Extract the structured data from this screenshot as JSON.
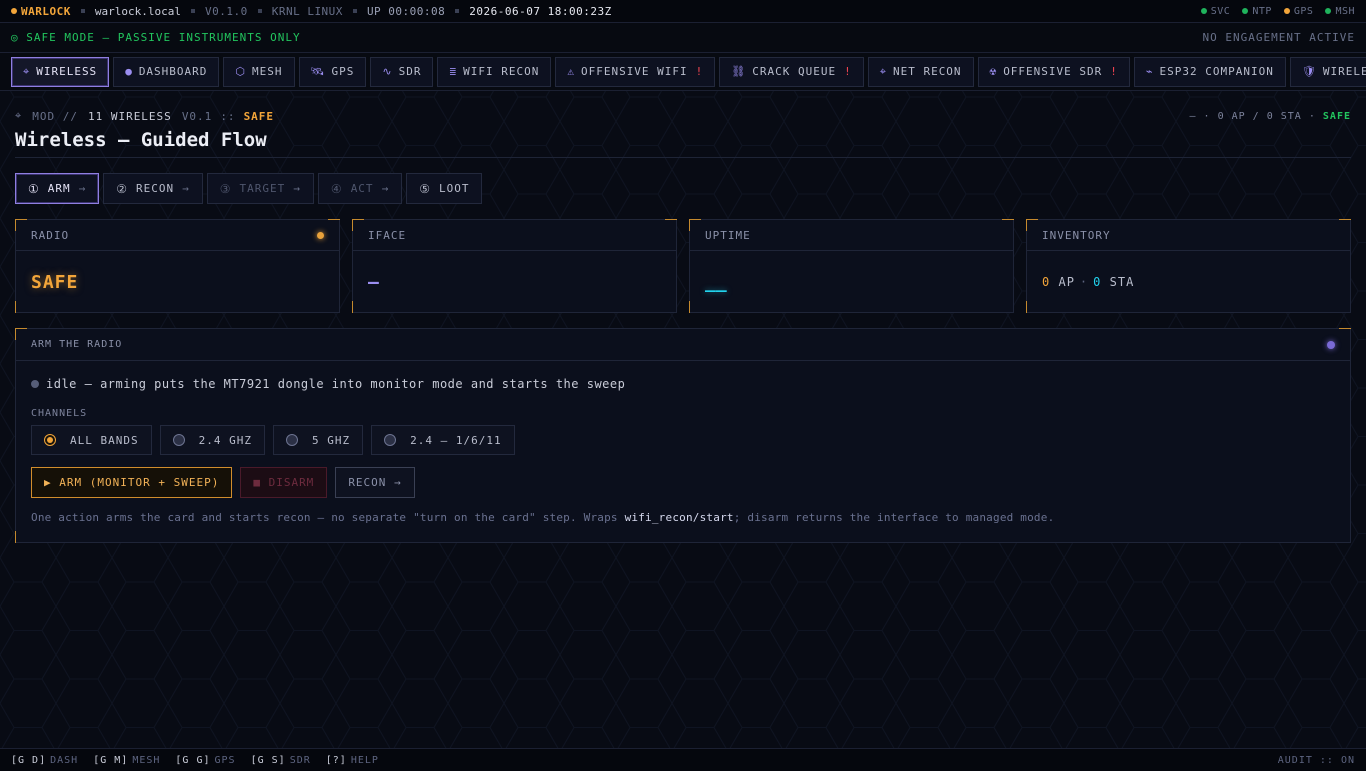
{
  "topbar": {
    "brand": "WARLOCK",
    "host": "warlock.local",
    "version": "V0.1.0",
    "kernel": "KRNL LINUX",
    "uptime": "UP 00:00:08",
    "clock": "2026-06-07 18:00:23Z",
    "indicators": [
      {
        "label": "SVC",
        "color": "#1fb35c"
      },
      {
        "label": "NTP",
        "color": "#1fb35c"
      },
      {
        "label": "GPS",
        "color": "#f2a53a"
      },
      {
        "label": "MSH",
        "color": "#1fb35c"
      }
    ]
  },
  "safebar": {
    "mode": "◎ SAFE MODE — PASSIVE INSTRUMENTS ONLY",
    "engagement": "NO ENGAGEMENT ACTIVE"
  },
  "nav": {
    "tabs": [
      {
        "icon": "⌖",
        "label": "WIRELESS",
        "warn": ""
      },
      {
        "icon": "●",
        "label": "DASHBOARD",
        "warn": ""
      },
      {
        "icon": "⬡",
        "label": "MESH",
        "warn": ""
      },
      {
        "icon": "🛰",
        "label": "GPS",
        "warn": ""
      },
      {
        "icon": "∿",
        "label": "SDR",
        "warn": ""
      },
      {
        "icon": "≣",
        "label": "WIFI RECON",
        "warn": ""
      },
      {
        "icon": "⚠",
        "label": "OFFENSIVE WIFI",
        "warn": "!"
      },
      {
        "icon": "⛓",
        "label": "CRACK QUEUE",
        "warn": "!"
      },
      {
        "icon": "⌖",
        "label": "NET RECON",
        "warn": ""
      },
      {
        "icon": "☢",
        "label": "OFFENSIVE SDR",
        "warn": "!"
      },
      {
        "icon": "⌁",
        "label": "ESP32 COMPANION",
        "warn": ""
      },
      {
        "icon": "🛡",
        "label": "WIRELESS IDS",
        "warn": ""
      }
    ]
  },
  "module": {
    "icon": "⌖",
    "prefix": "MOD //",
    "name": "11 WIRELESS",
    "version": "V0.1",
    "separator": "::",
    "state": "SAFE",
    "summary_prefix": "— · 0 AP / 0 STA ·",
    "summary_state": "SAFE",
    "title": "Wireless — Guided Flow"
  },
  "steps": [
    {
      "num": "①",
      "label": "ARM",
      "arrow": "→"
    },
    {
      "num": "②",
      "label": "RECON",
      "arrow": "→"
    },
    {
      "num": "③",
      "label": "TARGET",
      "arrow": "→"
    },
    {
      "num": "④",
      "label": "ACT",
      "arrow": "→"
    },
    {
      "num": "⑤",
      "label": "LOOT",
      "arrow": ""
    }
  ],
  "cards": {
    "radio": {
      "label": "RADIO",
      "value": "SAFE"
    },
    "iface": {
      "label": "IFACE",
      "value": "—"
    },
    "uptime": {
      "label": "UPTIME",
      "value": "__"
    },
    "inventory": {
      "label": "INVENTORY",
      "ap_count": "0",
      "ap_label": "AP",
      "dot": "·",
      "sta_count": "0",
      "sta_label": "STA"
    }
  },
  "arm_panel": {
    "title": "ARM THE RADIO",
    "status": "idle — arming puts the MT7921 dongle into monitor mode and starts the sweep",
    "channels_label": "CHANNELS",
    "channels": [
      {
        "label": "ALL BANDS",
        "selected": true
      },
      {
        "label": "2.4 GHZ",
        "selected": false
      },
      {
        "label": "5 GHZ",
        "selected": false
      },
      {
        "label": "2.4 — 1/6/11",
        "selected": false
      }
    ],
    "arm_button": "▶ ARM (MONITOR + SWEEP)",
    "disarm_button": "■ DISARM",
    "recon_button": "RECON →",
    "note_before": "One action arms the card and starts recon — no separate \"turn on the card\" step. Wraps ",
    "note_code": "wifi_recon/start",
    "note_after": "; disarm returns the interface to managed mode."
  },
  "bottombar": {
    "shortcuts": [
      {
        "key": "[G D]",
        "label": "DASH"
      },
      {
        "key": "[G M]",
        "label": "MESH"
      },
      {
        "key": "[G G]",
        "label": "GPS"
      },
      {
        "key": "[G S]",
        "label": "SDR"
      },
      {
        "key": "[?]",
        "label": "HELP"
      }
    ],
    "audit": "AUDIT :: ON"
  }
}
